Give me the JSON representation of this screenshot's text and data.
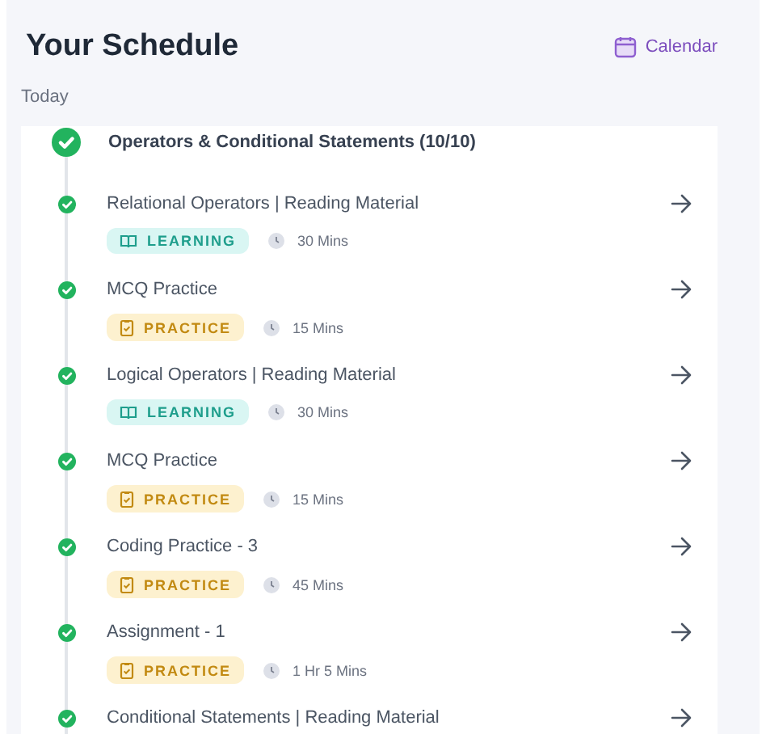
{
  "header": {
    "title": "Your Schedule",
    "calendar_link": "Calendar"
  },
  "day_label": "Today",
  "module": {
    "title": "Operators & Conditional Statements (10/10)",
    "done": true
  },
  "items": [
    {
      "title": "Relational Operators | Reading Material",
      "done": true,
      "tag": {
        "kind": "learning",
        "label": "LEARNING"
      },
      "duration": "30 Mins"
    },
    {
      "title": "MCQ Practice",
      "done": true,
      "tag": {
        "kind": "practice",
        "label": "PRACTICE"
      },
      "duration": "15 Mins"
    },
    {
      "title": "Logical Operators | Reading Material",
      "done": true,
      "tag": {
        "kind": "learning",
        "label": "LEARNING"
      },
      "duration": "30 Mins"
    },
    {
      "title": "MCQ Practice",
      "done": true,
      "tag": {
        "kind": "practice",
        "label": "PRACTICE"
      },
      "duration": "15 Mins"
    },
    {
      "title": "Coding Practice - 3",
      "done": true,
      "tag": {
        "kind": "practice",
        "label": "PRACTICE"
      },
      "duration": "45 Mins"
    },
    {
      "title": "Assignment - 1",
      "done": true,
      "tag": {
        "kind": "practice",
        "label": "PRACTICE"
      },
      "duration": "1 Hr 5 Mins"
    },
    {
      "title": "Conditional Statements | Reading Material",
      "done": true
    }
  ]
}
